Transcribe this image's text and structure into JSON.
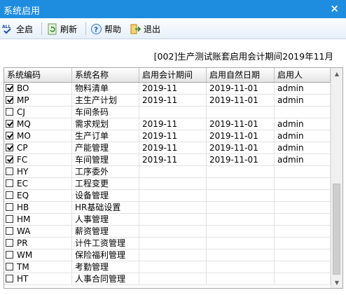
{
  "window": {
    "title": "系统启用",
    "close_glyph": "×"
  },
  "toolbar": {
    "all_label": "全启",
    "refresh_label": "刷新",
    "help_label": "帮助",
    "exit_label": "退出"
  },
  "period_text": "[002]生产测试账套启用会计期间2019年11月",
  "columns": [
    "系统编码",
    "系统名称",
    "启用会计期间",
    "启用自然日期",
    "启用人"
  ],
  "rows": [
    {
      "checked": true,
      "code": "BO",
      "name": "物料清单",
      "period": "2019-11",
      "date": "2019-11-01",
      "user": "admin"
    },
    {
      "checked": true,
      "code": "MP",
      "name": "主生产计划",
      "period": "2019-11",
      "date": "2019-11-01",
      "user": "admin"
    },
    {
      "checked": false,
      "code": "CJ",
      "name": "车间条码",
      "period": "",
      "date": "",
      "user": ""
    },
    {
      "checked": true,
      "code": "MQ",
      "name": "需求规划",
      "period": "2019-11",
      "date": "2019-11-01",
      "user": "admin"
    },
    {
      "checked": true,
      "code": "MO",
      "name": "生产订单",
      "period": "2019-11",
      "date": "2019-11-01",
      "user": "admin"
    },
    {
      "checked": true,
      "code": "CP",
      "name": "产能管理",
      "period": "2019-11",
      "date": "2019-11-01",
      "user": "admin"
    },
    {
      "checked": true,
      "code": "FC",
      "name": "车间管理",
      "period": "2019-11",
      "date": "2019-11-01",
      "user": "admin"
    },
    {
      "checked": false,
      "code": "HY",
      "name": "工序委外",
      "period": "",
      "date": "",
      "user": ""
    },
    {
      "checked": false,
      "code": "EC",
      "name": "工程变更",
      "period": "",
      "date": "",
      "user": ""
    },
    {
      "checked": false,
      "code": "EQ",
      "name": "设备管理",
      "period": "",
      "date": "",
      "user": ""
    },
    {
      "checked": false,
      "code": "HB",
      "name": "HR基础设置",
      "period": "",
      "date": "",
      "user": ""
    },
    {
      "checked": false,
      "code": "HM",
      "name": "人事管理",
      "period": "",
      "date": "",
      "user": ""
    },
    {
      "checked": false,
      "code": "WA",
      "name": "薪资管理",
      "period": "",
      "date": "",
      "user": ""
    },
    {
      "checked": false,
      "code": "PR",
      "name": "计件工资管理",
      "period": "",
      "date": "",
      "user": ""
    },
    {
      "checked": false,
      "code": "WM",
      "name": "保险福利管理",
      "period": "",
      "date": "",
      "user": ""
    },
    {
      "checked": false,
      "code": "TM",
      "name": "考勤管理",
      "period": "",
      "date": "",
      "user": ""
    },
    {
      "checked": false,
      "code": "HT",
      "name": "人事合同管理",
      "period": "",
      "date": "",
      "user": ""
    }
  ],
  "icons": {
    "all": "select-all-icon",
    "refresh": "refresh-icon",
    "help": "help-icon",
    "exit": "exit-icon"
  },
  "colors": {
    "titlebar": "#1e8de0",
    "toolbar_top": "#fbfdff",
    "toolbar_bottom": "#e6eff9"
  }
}
